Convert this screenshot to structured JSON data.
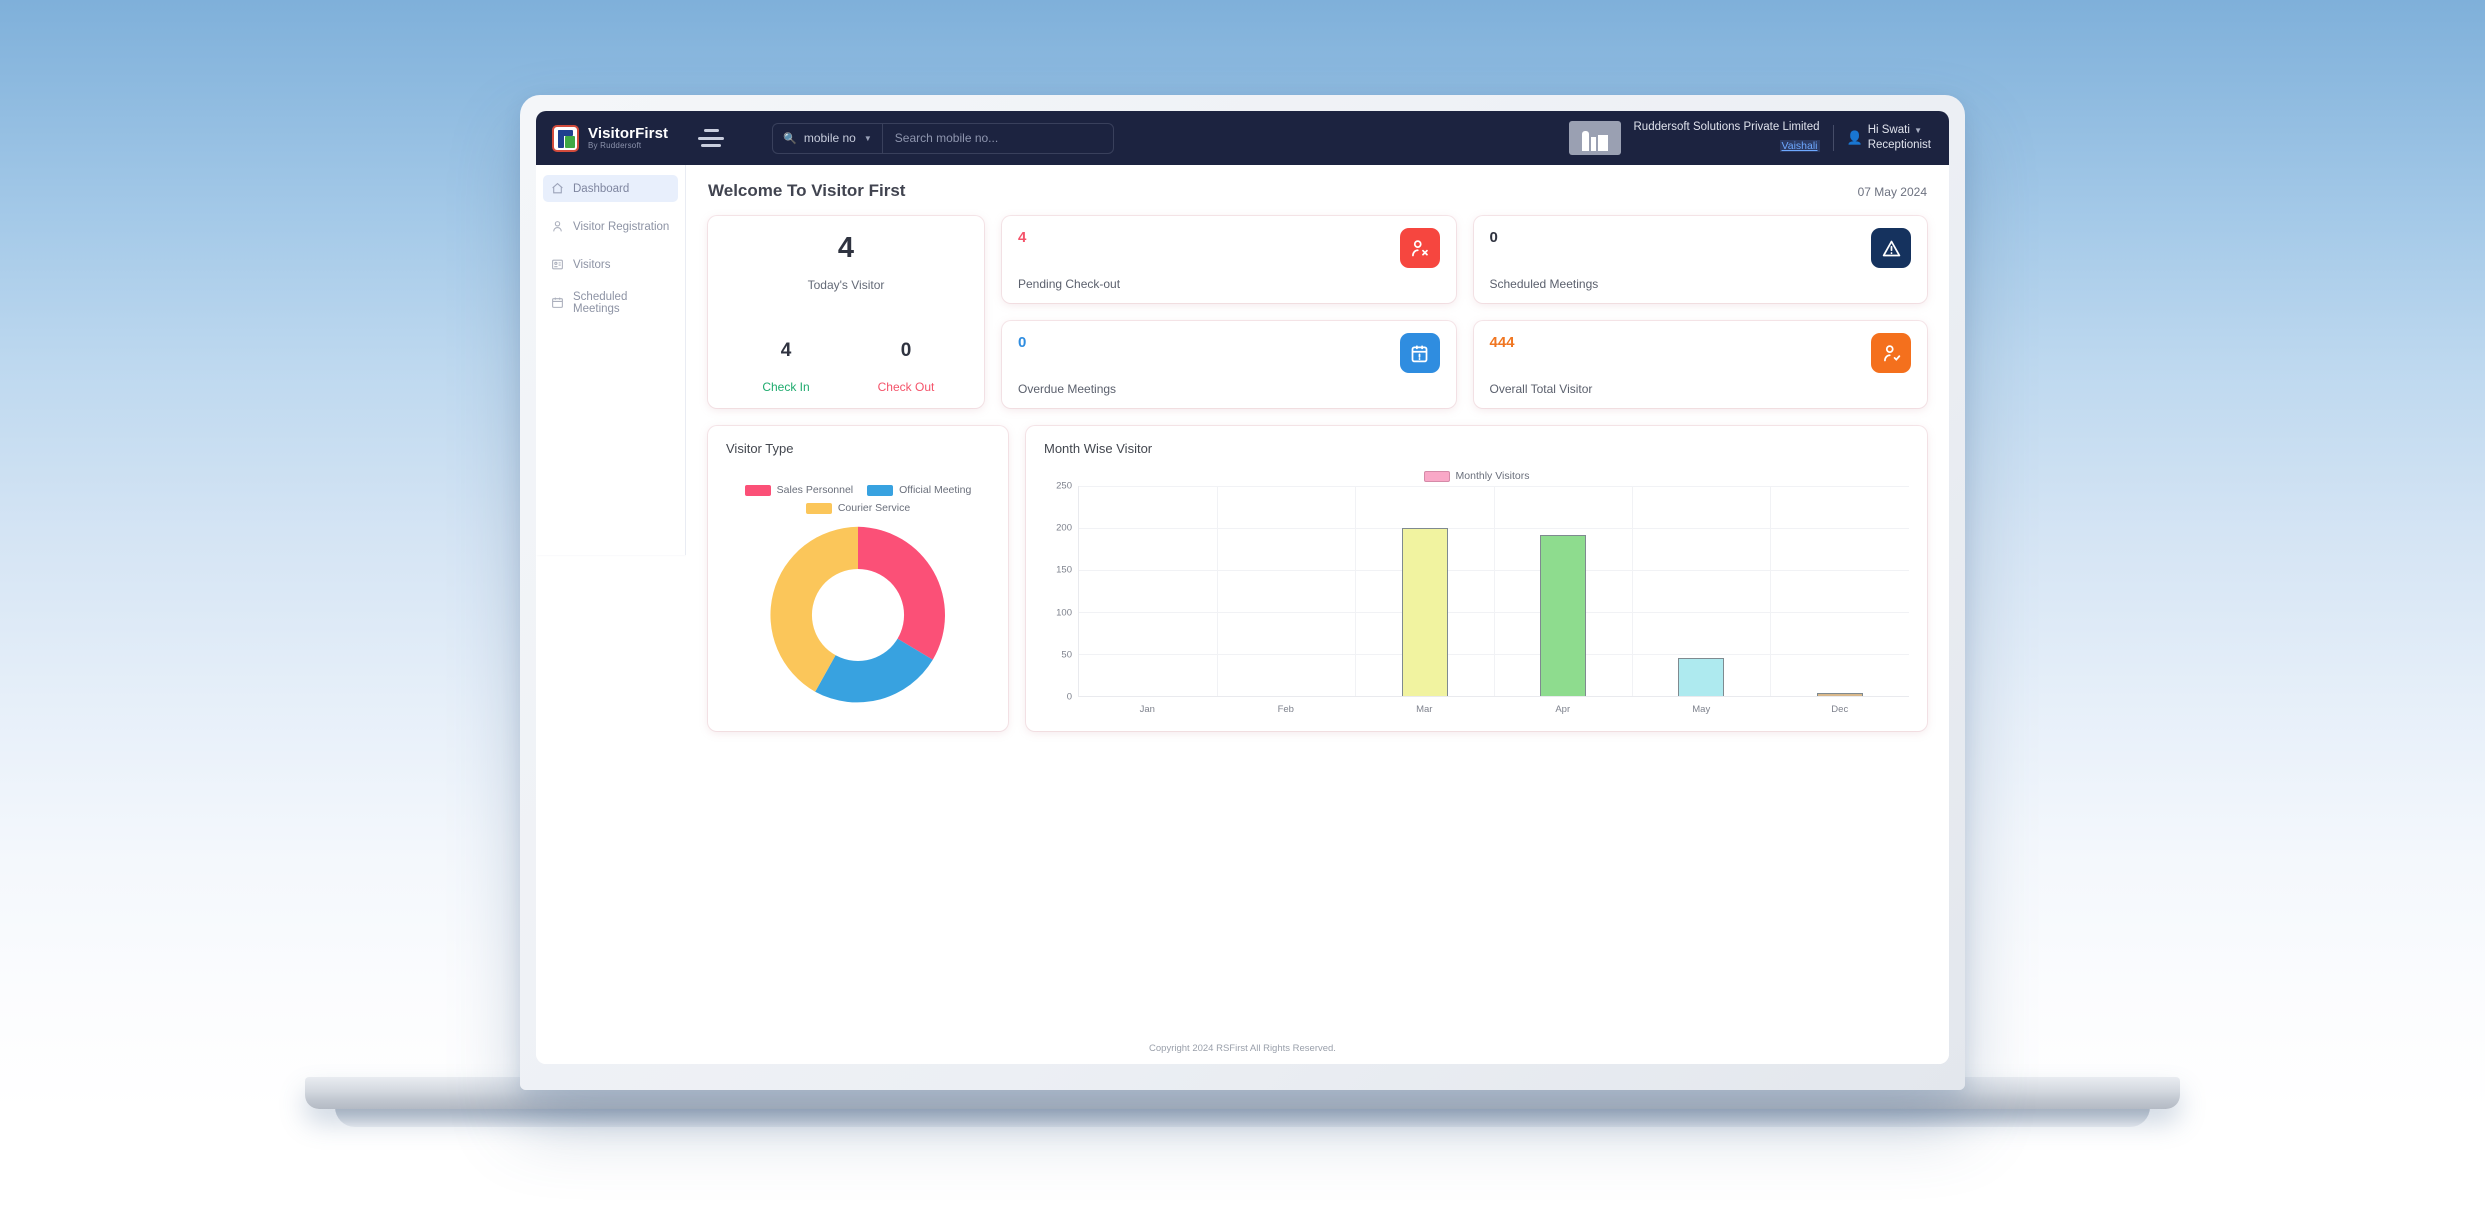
{
  "topbar": {
    "brand_title": "VisitorFirst",
    "brand_sub": "By Ruddersoft",
    "search_select_label": "mobile no",
    "search_placeholder": "Search mobile no...",
    "search_value": "",
    "company_name": "Ruddersoft Solutions Private Limited",
    "company_link": "Vaishali",
    "user_greeting": "Hi Swati",
    "user_role": "Receptionist"
  },
  "sidebar": {
    "items": [
      {
        "label": "Dashboard",
        "icon": "home-icon",
        "active": true
      },
      {
        "label": "Visitor Registration",
        "icon": "user-icon",
        "active": false
      },
      {
        "label": "Visitors",
        "icon": "id-card-icon",
        "active": false
      },
      {
        "label": "Scheduled Meetings",
        "icon": "calendar-icon",
        "active": false
      }
    ]
  },
  "page": {
    "title": "Welcome To Visitor First",
    "date": "07 May 2024"
  },
  "stats": {
    "today": {
      "value": "4",
      "label": "Today's Visitor",
      "check_in_value": "4",
      "check_in_label": "Check In",
      "check_out_value": "0",
      "check_out_label": "Check Out",
      "check_in_color": "#1fab6e",
      "check_out_color": "#f4536a"
    },
    "cards": [
      {
        "value": "4",
        "label": "Pending Check-out",
        "value_color": "#f4536a",
        "icon": "user-pending-icon",
        "icon_bg": "#f6463f"
      },
      {
        "value": "0",
        "label": "Scheduled Meetings",
        "value_color": "#2f3340",
        "icon": "alert-triangle-icon",
        "icon_bg": "#15325e"
      },
      {
        "value": "0",
        "label": "Overdue Meetings",
        "value_color": "#2f8de0",
        "icon": "calendar-alert-icon",
        "icon_bg": "#2f8de0"
      },
      {
        "value": "444",
        "label": "Overall Total Visitor",
        "value_color": "#f07621",
        "icon": "user-check-icon",
        "icon_bg": "#f4701d"
      }
    ]
  },
  "chart_data": [
    {
      "type": "pie",
      "title": "Visitor Type",
      "legend_position": "top",
      "labels": [
        "Sales Personnel",
        "Official Meeting",
        "Courier Service"
      ],
      "values": [
        34,
        33,
        33
      ],
      "colors": [
        "#fb5077",
        "#38a2e0",
        "#fbc65a"
      ],
      "donut": true,
      "inner_radius_ratio": 0.53
    },
    {
      "type": "bar",
      "title": "Month Wise Visitor",
      "legend_position": "top",
      "legend": [
        "Monthly Visitors"
      ],
      "categories": [
        "Jan",
        "Feb",
        "Mar",
        "Apr",
        "May",
        "Dec"
      ],
      "values": [
        0,
        0,
        200,
        192,
        45,
        3
      ],
      "bar_colors": [
        "#f9a8c7",
        "#f9a8c7",
        "#f1f3a0",
        "#8edc8e",
        "#aeeaef",
        "#d8b78a"
      ],
      "ylim": [
        0,
        250
      ],
      "yticks": [
        0,
        50,
        100,
        150,
        200,
        250
      ],
      "xlabel": "",
      "ylabel": "",
      "grid": true
    }
  ],
  "footer": {
    "text": "Copyright 2024 RSFirst All Rights Reserved."
  }
}
